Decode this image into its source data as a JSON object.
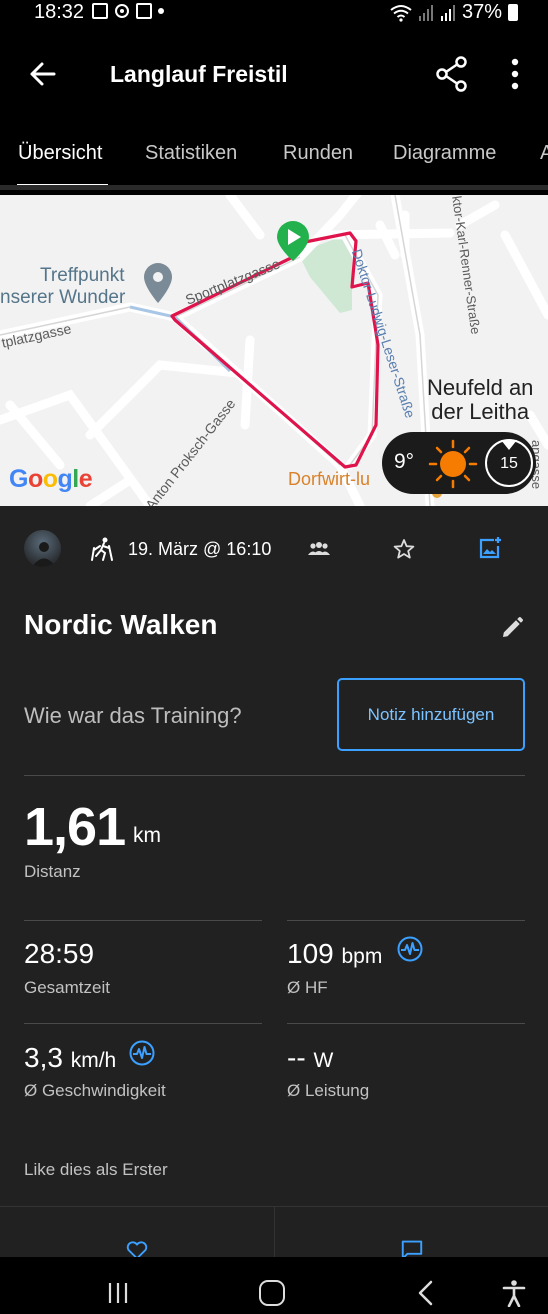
{
  "status_bar": {
    "time": "18:32",
    "battery": "37%",
    "icons": [
      "gallery-icon",
      "location-icon",
      "amazon-icon",
      "dot-icon",
      "wifi-icon",
      "signal-icon",
      "signal-icon",
      "battery-icon"
    ]
  },
  "app_bar": {
    "title": "Langlauf Freistil",
    "icons": [
      "back-arrow-icon",
      "share-icon",
      "more-vert-icon"
    ]
  },
  "tabs": [
    {
      "label": "Übersicht",
      "active": true
    },
    {
      "label": "Statistiken",
      "active": false
    },
    {
      "label": "Runden",
      "active": false
    },
    {
      "label": "Diagramme",
      "active": false
    },
    {
      "label": "A",
      "active": false
    }
  ],
  "map": {
    "poi_label_line1": "Treffpunkt",
    "poi_label_line2": "nserer Wunder",
    "street_1": "Sportplatzgasse",
    "street_2": "tplatzgasse",
    "street_3": "Anton Proksch-Gasse",
    "street_4": "Doktor-Ludwig-Leser-Straße",
    "street_5": "ktor-Karl-Renner-Straße",
    "street_6": "angasse",
    "town_line1": "Neufeld an",
    "town_line2": "der Leitha",
    "shop_label": "Dorfwirt-lu",
    "google_logo": "Google",
    "route_color": "#e0144c",
    "start_marker_color": "#22b14c",
    "weather": {
      "temperature": "9°",
      "wind_speed": "15",
      "icon": "sun-icon"
    }
  },
  "activity": {
    "date": "19. März @ 16:10",
    "name": "Nordic Walken",
    "question": "Wie war das Training?",
    "note_button": "Notiz hinzufügen",
    "icons": [
      "avatar",
      "nordic-walking-icon",
      "group-icon",
      "star-icon",
      "add-photo-icon",
      "edit-pencil-icon"
    ]
  },
  "stats": {
    "distance": {
      "value": "1,61",
      "unit": "km",
      "label": "Distanz"
    },
    "total_time": {
      "value": "28:59",
      "label": "Gesamtzeit"
    },
    "heart_rate": {
      "value": "109",
      "unit": "bpm",
      "label": "Ø HF"
    },
    "speed": {
      "value": "3,3",
      "unit": "km/h",
      "label": "Ø Geschwindigkeit"
    },
    "power": {
      "value": "--",
      "unit": "W",
      "label": "Ø Leistung"
    }
  },
  "social": {
    "like_text": "Like dies als Erster"
  },
  "accent_color": "#3ba0ff"
}
